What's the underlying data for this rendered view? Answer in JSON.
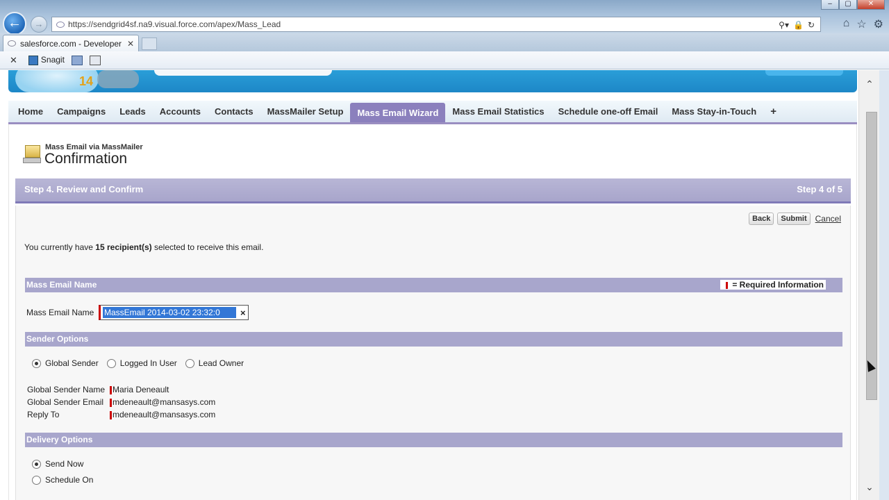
{
  "browser": {
    "url": "https://sendgrid4sf.na9.visual.force.com/apex/Mass_Lead",
    "tab_title": "salesforce.com - Developer ...",
    "toolbar": {
      "snagit_label": "Snagit"
    }
  },
  "header": {
    "logo_badge": "14"
  },
  "nav": {
    "tabs": [
      {
        "label": "Home",
        "active": false
      },
      {
        "label": "Campaigns",
        "active": false
      },
      {
        "label": "Leads",
        "active": false
      },
      {
        "label": "Accounts",
        "active": false
      },
      {
        "label": "Contacts",
        "active": false
      },
      {
        "label": "MassMailer Setup",
        "active": false
      },
      {
        "label": "Mass Email Wizard",
        "active": true
      },
      {
        "label": "Mass Email Statistics",
        "active": false
      },
      {
        "label": "Schedule one-off Email",
        "active": false
      },
      {
        "label": "Mass Stay-in-Touch",
        "active": false
      }
    ],
    "plus": "+"
  },
  "page": {
    "subtitle": "Mass Email via MassMailer",
    "title": "Confirmation"
  },
  "step": {
    "left": "Step 4. Review and Confirm",
    "right": "Step 4 of 5"
  },
  "actions": {
    "back": "Back",
    "submit": "Submit",
    "cancel": "Cancel"
  },
  "recipients": {
    "prefix": "You currently have ",
    "count": "15 recipient(s)",
    "suffix": " selected to receive this email."
  },
  "sections": {
    "mass_email_name": "Mass Email Name",
    "required_info": "= Required Information",
    "sender_options": "Sender Options",
    "delivery_options": "Delivery Options"
  },
  "form": {
    "name_label": "Mass Email Name",
    "name_value": "MassEmail  2014-03-02 23:32:0",
    "clear": "×"
  },
  "sender": {
    "options": [
      {
        "label": "Global Sender",
        "selected": true
      },
      {
        "label": "Logged In User",
        "selected": false
      },
      {
        "label": "Lead Owner",
        "selected": false
      }
    ],
    "global_name_label": "Global Sender Name",
    "global_name_value": "Maria Deneault",
    "global_email_label": "Global Sender Email",
    "global_email_value": "mdeneault@mansasys.com",
    "reply_to_label": "Reply To",
    "reply_to_value": "mdeneault@mansasys.com"
  },
  "delivery": {
    "options": [
      {
        "label": "Send Now",
        "selected": true
      },
      {
        "label": "Schedule On",
        "selected": false
      }
    ]
  },
  "icons": {
    "back": "back-arrow-icon",
    "forward": "forward-arrow-icon",
    "home": "home-icon",
    "favorites": "star-icon",
    "settings": "gear-icon"
  }
}
